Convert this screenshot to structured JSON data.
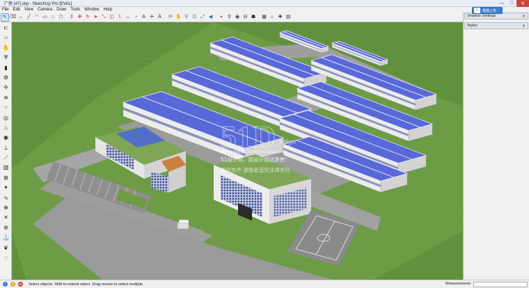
{
  "window": {
    "title": "厂房 (47).skp - SketchUp Pro [EVAL]",
    "min": "—",
    "max": "□",
    "close": "✕"
  },
  "menu": [
    "File",
    "Edit",
    "View",
    "Camera",
    "Draw",
    "Tools",
    "Window",
    "Help"
  ],
  "toolbar": {
    "icons": [
      "select-icon",
      "eraser-icon",
      "paint-bucket-icon",
      "line-icon",
      "arc-icon",
      "rectangle-icon",
      "circle-icon",
      "polygon-icon",
      "push-pull-icon",
      "move-icon",
      "rotate-icon",
      "follow-me-icon",
      "scale-icon",
      "offset-icon",
      "tape-measure-icon",
      "dimension-icon",
      "protractor-icon",
      "text-icon",
      "axes-icon",
      "3d-text-icon",
      "orbit-icon",
      "pan-icon",
      "zoom-icon",
      "zoom-window-icon",
      "zoom-extents-icon",
      "previous-view-icon",
      "position-camera-icon",
      "walk-icon",
      "look-around-icon",
      "section-plane-icon",
      "footprint-icon",
      "component-icon",
      "warehouse-icon",
      "extension-icon",
      "layout-icon"
    ]
  },
  "lefttools": [
    "section-icon",
    "follow-me-icon",
    "hand-icon",
    "shield-icon",
    "cylinder-icon",
    "gear-icon",
    "cross-icon",
    "wave-icon",
    "dots-icon",
    "circle-icon",
    "flame-icon",
    "target-icon",
    "nail-icon",
    "knife-icon",
    "ruler-icon",
    "grid-icon",
    "star-icon",
    "tilde-icon",
    "globe-icon",
    "x-icon",
    "spiral-icon",
    "anchor-icon",
    "leaf-icon",
    "ring-icon"
  ],
  "tray": {
    "float_label": "拖拽上传",
    "panels": [
      {
        "label": "Shadow Settings",
        "close": "✕"
      },
      {
        "label": "Styles",
        "close": "✕"
      }
    ]
  },
  "watermark": {
    "logo": "51D",
    "logo_suffix": "esign",
    "line1": "http://shop12716690.taobao.com",
    "line2": "51设计网，用设计成就梦想！",
    "line3": "原创文件   盗图者追究法律责任"
  },
  "status": {
    "message": "Select objects. Shift to extend select. Drag mouse to select multiple.",
    "measurements_label": "Measurements",
    "icons": [
      {
        "name": "info-icon",
        "color": "#3b7fd0",
        "glyph": "i"
      },
      {
        "name": "credit-icon",
        "color": "#d9a319",
        "glyph": "$"
      },
      {
        "name": "user-icon",
        "color": "#c9463d",
        "glyph": "●"
      }
    ]
  },
  "colors": {
    "grass": "#62913e",
    "road": "#9b9b9b",
    "roof": "#5a6ad8",
    "wall": "#ececec",
    "accent": "#3b7fd0"
  }
}
